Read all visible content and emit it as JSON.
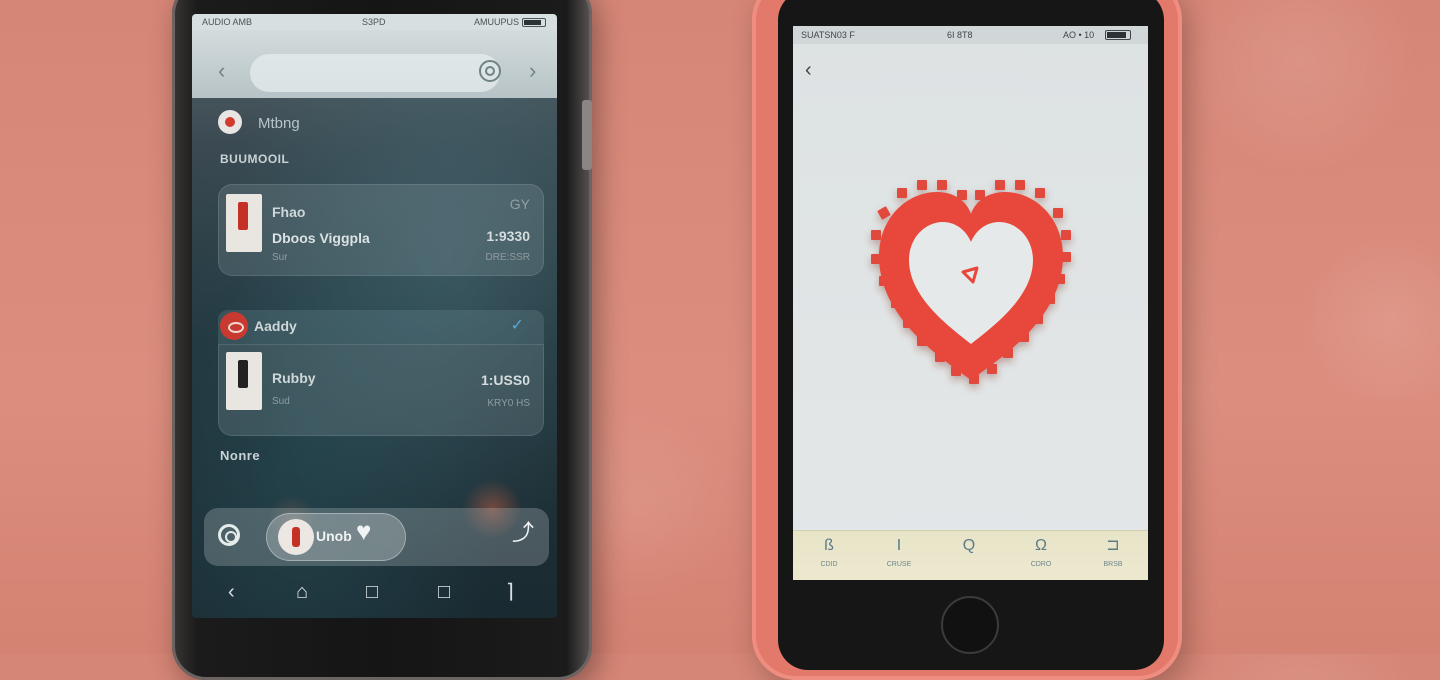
{
  "left_phone": {
    "status_bar": {
      "left": "AUDIO AMB",
      "center": "S3PD",
      "right": "AMUUPUS"
    },
    "section_header_1": "BUUMOOIL",
    "mixed_item": {
      "label": "Mtbng"
    },
    "cards": [
      {
        "title": "Fhao",
        "subtitle": "Dboos Viggpla",
        "meta": "Sur",
        "icon": "GY",
        "price": "1:9330",
        "small": "DRE:SSR"
      },
      {
        "title": "Rubby",
        "subtitle": "",
        "meta": "Sud",
        "icon": "",
        "price": "1:USS0",
        "small": "KRY0 HS"
      }
    ],
    "red_row": {
      "label": "Aaddy"
    },
    "section_header_2": "Nonre",
    "dock": {
      "center_label": "Unob"
    }
  },
  "right_phone": {
    "status_bar": {
      "left": "SUATSN03 F",
      "center": "6I 8T8",
      "right": "AO • 10"
    },
    "tabs": [
      {
        "icon": "ß",
        "label": "CDID"
      },
      {
        "icon": "I",
        "label": "CRUSE"
      },
      {
        "icon": "Q",
        "label": ""
      },
      {
        "icon": "Ω",
        "label": "CDRO"
      },
      {
        "icon": "⊐",
        "label": "BRSB"
      }
    ]
  },
  "colors": {
    "accent_red": "#e8473a",
    "background": "#d9897a",
    "phone_case": "#e2796a"
  }
}
